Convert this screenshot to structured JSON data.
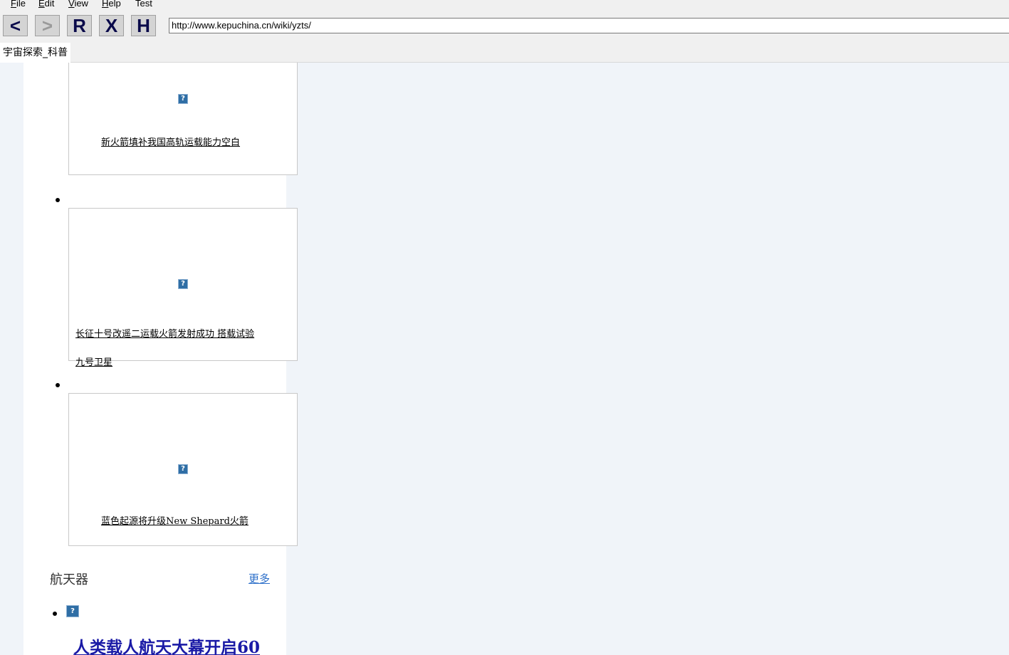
{
  "menu": {
    "file": {
      "key": "F",
      "rest": "ile"
    },
    "edit": {
      "key": "E",
      "rest": "dit"
    },
    "view": {
      "key": "V",
      "rest": "iew"
    },
    "help": {
      "key": "H",
      "rest": "elp"
    },
    "test": "Test"
  },
  "toolbar": {
    "back_label": "<",
    "forward_label": ">",
    "reload_label": "R",
    "stop_label": "X",
    "home_label": "H",
    "url": "http://www.kepuchina.cn/wiki/yzts/"
  },
  "tab": {
    "title": "宇宙探索_科普"
  },
  "broken_image_glyph": "?",
  "cards": [
    {
      "caption_lines": [
        "新火箭填补我国高轨运载能力空白"
      ]
    },
    {
      "caption_lines": [
        "长征十号改遥二运载火箭发射成功 搭载试验",
        "九号卫星"
      ]
    },
    {
      "caption_lines": [
        "蓝色起源将升级New Shepard火箭"
      ]
    }
  ],
  "section": {
    "title": "航天器",
    "more_label": "更多"
  },
  "headline": "人类载人航天大幕开启60",
  "colors": {
    "page_bg": "#f0f4f9",
    "link_blue": "#2c6fc9",
    "headline_blue": "#1a1aa6",
    "chrome": "#f0f0f0"
  }
}
